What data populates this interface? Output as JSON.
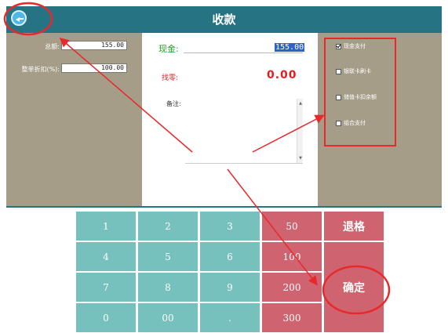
{
  "header": {
    "title": "收款"
  },
  "left_form": {
    "total_label": "总额:",
    "total_value": "155.00",
    "discount_label": "整单折扣(%):",
    "discount_value": "100.00"
  },
  "center": {
    "cash_label": "现金:",
    "cash_value": "155.00",
    "change_label": "找零:",
    "change_value": "0.00",
    "remark_label": "备注:"
  },
  "payment_options": [
    {
      "label": "现金支付",
      "checked": true
    },
    {
      "label": "银联卡刷卡",
      "checked": false
    },
    {
      "label": "储值卡扣余额",
      "checked": false
    },
    {
      "label": "组合支付",
      "checked": false
    }
  ],
  "keypad": {
    "k1": "1",
    "k2": "2",
    "k3": "3",
    "k50": "50",
    "refund": "退格",
    "k4": "4",
    "k5": "5",
    "k6": "6",
    "k100": "100",
    "k7": "7",
    "k8": "8",
    "k9": "9",
    "k200": "200",
    "confirm": "确定",
    "k0": "0",
    "k00": "00",
    "dot": ".",
    "k300": "300"
  },
  "colors": {
    "header": "#267483",
    "panel": "#a59d87",
    "key_teal": "#76c0bd",
    "key_red": "#cf6470",
    "annotation": "#e8292b"
  },
  "icons": {
    "back": "back-arrow-icon"
  }
}
